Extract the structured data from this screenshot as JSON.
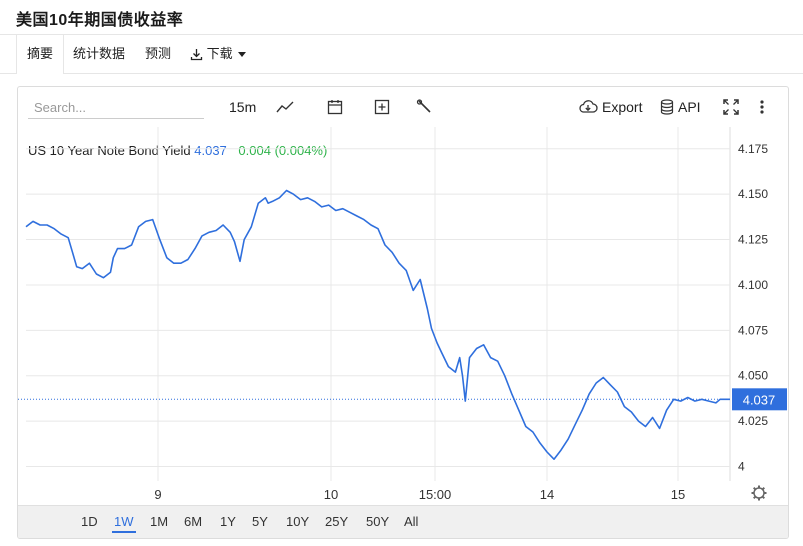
{
  "page_title": "美国10年期国债收益率",
  "tabs": [
    {
      "label": "摘要",
      "active": true
    },
    {
      "label": "统计数据"
    },
    {
      "label": "预测"
    },
    {
      "label": "下载"
    }
  ],
  "toolbar": {
    "search_placeholder": "Search...",
    "interval": "15m",
    "export_label": "Export",
    "api_label": "API"
  },
  "legend": {
    "symbol": "US 10 Year Note Bond Yield",
    "last": "4.037",
    "change": "0.004 (0.004%)"
  },
  "colors": {
    "line": "#2f6fdd",
    "change": "#2eb34a",
    "grid": "#e8e8e8"
  },
  "chart_data": {
    "type": "line",
    "series": [
      {
        "name": "US 10 Year Note Bond Yield",
        "t": [
          0,
          0.05,
          0.1,
          0.15,
          0.2,
          0.25,
          0.3,
          0.33,
          0.36,
          0.4,
          0.45,
          0.5,
          0.55,
          0.6,
          0.62,
          0.65,
          0.7,
          0.75,
          0.8,
          0.85,
          0.9,
          0.95,
          1.0,
          1.05,
          1.1,
          1.15,
          1.2,
          1.25,
          1.3,
          1.35,
          1.4,
          1.45,
          1.48,
          1.52,
          1.55,
          1.6,
          1.65,
          1.7,
          1.72,
          1.75,
          1.8,
          1.85,
          1.9,
          1.95,
          2.0,
          2.05,
          2.1,
          2.15,
          2.2,
          2.25,
          2.3,
          2.35,
          2.4,
          2.45,
          2.5,
          2.55,
          2.6,
          2.65,
          2.7,
          2.75,
          2.8,
          2.85,
          2.88,
          2.92,
          2.95,
          3.0,
          3.05,
          3.08,
          3.1,
          3.12,
          3.15,
          3.2,
          3.25,
          3.3,
          3.35,
          3.4,
          3.45,
          3.5,
          3.55,
          3.6,
          3.65,
          3.7,
          3.75,
          3.8,
          3.85,
          3.9,
          3.95,
          4.0,
          4.05,
          4.1,
          4.15,
          4.2,
          4.25,
          4.3,
          4.35,
          4.4,
          4.45,
          4.5,
          4.55,
          4.6,
          4.65,
          4.7,
          4.75,
          4.8,
          4.85,
          4.9,
          4.93,
          4.96,
          5.0
        ],
        "values": [
          4.132,
          4.135,
          4.133,
          4.133,
          4.131,
          4.128,
          4.126,
          4.118,
          4.11,
          4.109,
          4.112,
          4.106,
          4.104,
          4.107,
          4.115,
          4.12,
          4.12,
          4.122,
          4.132,
          4.135,
          4.136,
          4.125,
          4.115,
          4.112,
          4.112,
          4.114,
          4.12,
          4.127,
          4.129,
          4.13,
          4.133,
          4.129,
          4.124,
          4.113,
          4.125,
          4.132,
          4.145,
          4.148,
          4.145,
          4.146,
          4.148,
          4.152,
          4.15,
          4.147,
          4.148,
          4.146,
          4.143,
          4.144,
          4.141,
          4.142,
          4.14,
          4.138,
          4.136,
          4.133,
          4.131,
          4.122,
          4.118,
          4.112,
          4.108,
          4.097,
          4.103,
          4.087,
          4.076,
          4.068,
          4.063,
          4.055,
          4.052,
          4.06,
          4.05,
          4.036,
          4.06,
          4.065,
          4.067,
          4.06,
          4.058,
          4.05,
          4.04,
          4.031,
          4.022,
          4.019,
          4.013,
          4.008,
          4.004,
          4.009,
          4.015,
          4.023,
          4.031,
          4.04,
          4.046,
          4.049,
          4.045,
          4.041,
          4.033,
          4.03,
          4.025,
          4.022,
          4.027,
          4.021,
          4.031,
          4.037,
          4.036,
          4.038,
          4.036,
          4.037,
          4.036,
          4.035,
          4.037,
          4.037,
          4.037
        ],
        "color": "#2f6fdd"
      }
    ],
    "x_ticks": [
      "9",
      "10",
      "15:00",
      "14",
      "15"
    ],
    "y_ticks": [
      "4.175",
      "4.150",
      "4.125",
      "4.100",
      "4.075",
      "4.050",
      "4.025",
      "4"
    ],
    "ylim": [
      3.992,
      4.187
    ],
    "last_price": 4.037,
    "last_price_label": "4.037",
    "grid": true
  },
  "range_buttons": [
    {
      "label": "1D"
    },
    {
      "label": "1W",
      "active": true
    },
    {
      "label": "1M"
    },
    {
      "label": "6M"
    },
    {
      "label": "1Y"
    },
    {
      "label": "5Y"
    },
    {
      "label": "10Y"
    },
    {
      "label": "25Y"
    },
    {
      "label": "50Y"
    },
    {
      "label": "All"
    }
  ]
}
